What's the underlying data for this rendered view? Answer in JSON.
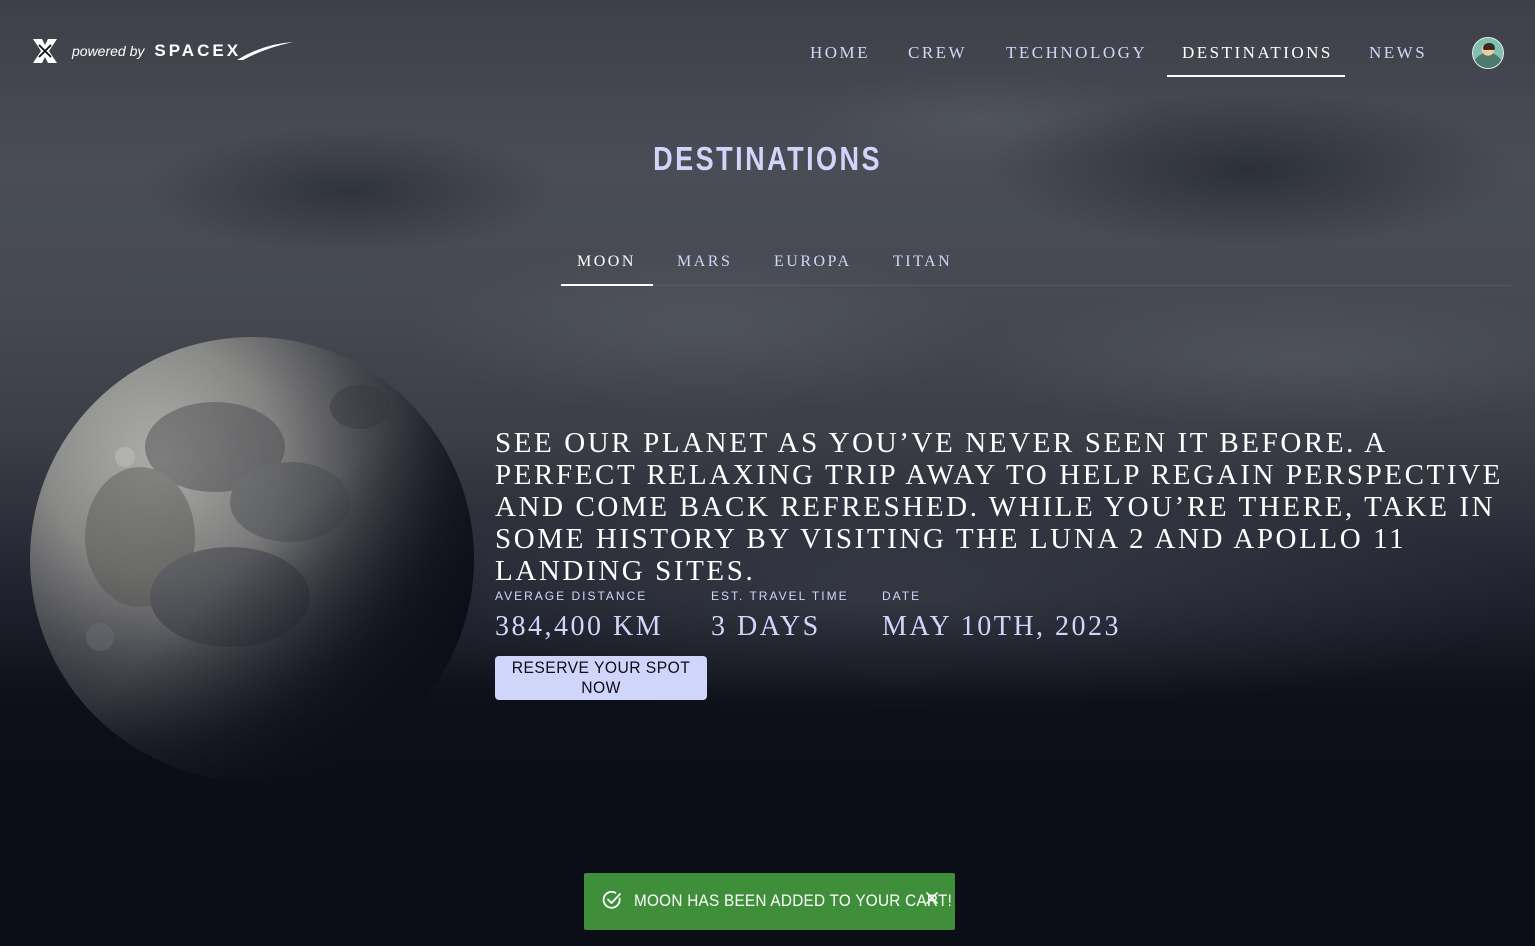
{
  "header": {
    "logo_tagline": "powered by",
    "logo_brand": "SPACEX",
    "nav": [
      {
        "label": "HOME",
        "active": false
      },
      {
        "label": "CREW",
        "active": false
      },
      {
        "label": "TECHNOLOGY",
        "active": false
      },
      {
        "label": "DESTINATIONS",
        "active": true
      },
      {
        "label": "NEWS",
        "active": false
      }
    ]
  },
  "page": {
    "title": "DESTINATIONS"
  },
  "tabs": [
    {
      "label": "MOON",
      "active": true
    },
    {
      "label": "MARS",
      "active": false
    },
    {
      "label": "EUROPA",
      "active": false
    },
    {
      "label": "TITAN",
      "active": false
    }
  ],
  "destination": {
    "name": "MOON",
    "description": "See our planet as you’ve never seen it before. A perfect relaxing trip away to help regain perspective and come back refreshed. While you’re there, take in some history by visiting the Luna 2 and Apollo 11 landing sites.",
    "stats": [
      {
        "label": "AVERAGE DISTANCE",
        "value": "384,400 KM"
      },
      {
        "label": "EST. TRAVEL TIME",
        "value": "3 DAYS"
      },
      {
        "label": "DATE",
        "value": "MAY 10TH, 2023"
      }
    ],
    "reserve_label": "RESERVE YOUR SPOT NOW"
  },
  "toast": {
    "message": "MOON HAS BEEN ADDED TO YOUR CART!",
    "color": "#3f8f3a"
  },
  "colors": {
    "background": "#0b0d17",
    "accent": "#d0d6f9",
    "text": "#ffffff"
  },
  "icons": {
    "logo": "spacex-x-logo-icon",
    "avatar": "user-avatar",
    "toast_status": "check-circle-icon",
    "toast_close": "close-icon"
  }
}
